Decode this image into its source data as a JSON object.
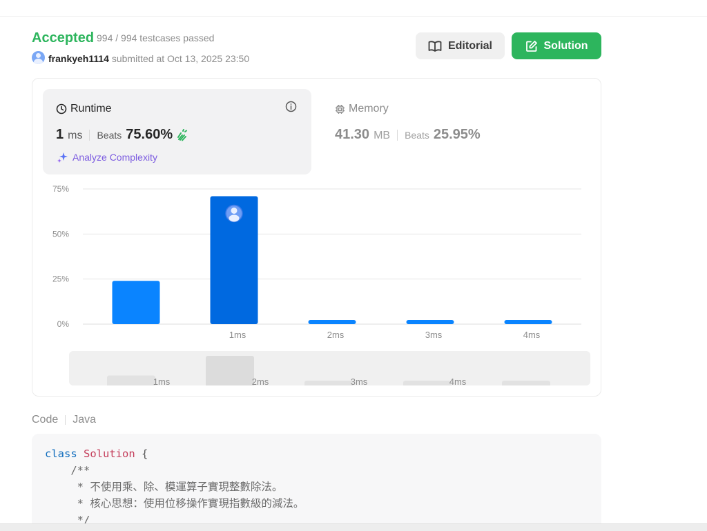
{
  "status": {
    "result": "Accepted",
    "testcases": "994 / 994 testcases passed",
    "username": "frankyeh1114",
    "submitted_text": "submitted at Oct 13, 2025 23:50"
  },
  "buttons": {
    "editorial": "Editorial",
    "solution": "Solution"
  },
  "runtime": {
    "title": "Runtime",
    "value": "1",
    "unit": "ms",
    "beats_label": "Beats",
    "beats_value": "75.60%",
    "analyze_label": "Analyze Complexity"
  },
  "memory": {
    "title": "Memory",
    "value": "41.30",
    "unit": "MB",
    "beats_label": "Beats",
    "beats_value": "25.95%"
  },
  "chart_data": {
    "type": "bar",
    "categories": [
      "",
      "1ms",
      "2ms",
      "3ms",
      "4ms"
    ],
    "values": [
      24,
      71,
      1.5,
      1.5,
      1.5
    ],
    "highlight_index": 1,
    "yticks": [
      "0%",
      "25%",
      "50%",
      "75%"
    ],
    "ylim": [
      0,
      75
    ],
    "grid": true,
    "bar_color": "#0a84ff",
    "highlight_color": "#0069e0"
  },
  "range_selector": {
    "labels": [
      "",
      "1ms",
      "2ms",
      "3ms",
      "4ms"
    ],
    "values": [
      24,
      71,
      1.5,
      1.5,
      1.5
    ]
  },
  "code": {
    "label": "Code",
    "language": "Java",
    "lines": [
      [
        {
          "t": "class",
          "c": "kw"
        },
        {
          "t": " ",
          "c": ""
        },
        {
          "t": "Solution",
          "c": "cls"
        },
        {
          "t": " {",
          "c": "punc"
        }
      ],
      [
        {
          "t": "    /**",
          "c": "cm"
        }
      ],
      [
        {
          "t": "     * 不使用乘、除、模運算子實現整數除法。",
          "c": "cm"
        }
      ],
      [
        {
          "t": "     * 核心思想：使用位移操作實現指數級的減法。",
          "c": "cm"
        }
      ],
      [
        {
          "t": "     */",
          "c": "cm"
        }
      ]
    ]
  },
  "colors": {
    "accepted": "#2db55d",
    "solution_button": "#2db55d",
    "bar": "#0a84ff",
    "analyze": "#7c5ce0"
  }
}
